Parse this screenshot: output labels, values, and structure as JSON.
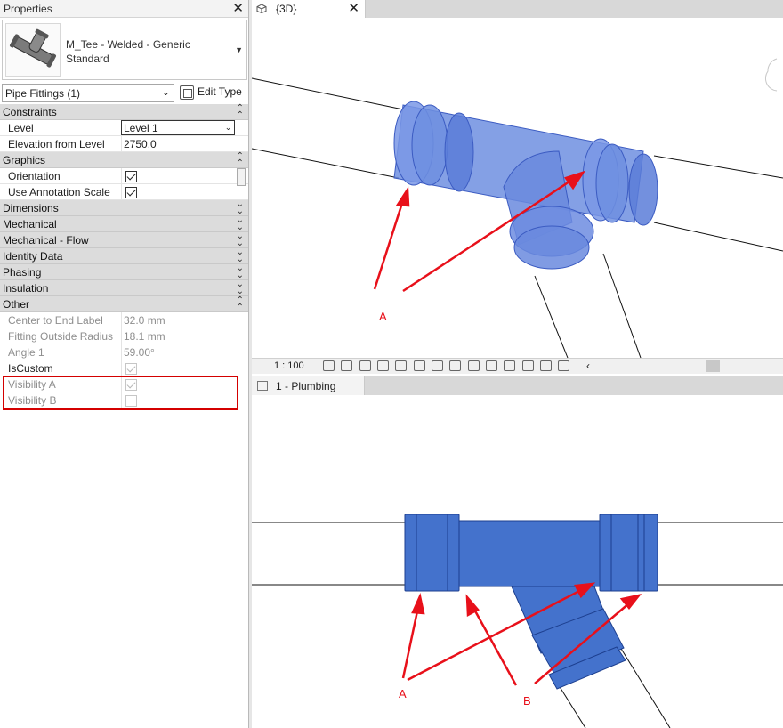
{
  "properties": {
    "title": "Properties",
    "type_name_line1": "M_Tee - Welded - Generic",
    "type_name_line2": "Standard",
    "filter": "Pipe Fittings (1)",
    "edit_type": "Edit Type",
    "groups": {
      "constraints": "Constraints",
      "graphics": "Graphics",
      "dimensions": "Dimensions",
      "mechanical": "Mechanical",
      "mechanical_flow": "Mechanical - Flow",
      "identity_data": "Identity Data",
      "phasing": "Phasing",
      "insulation": "Insulation",
      "other": "Other"
    },
    "params": {
      "level_label": "Level",
      "level_value": "Level 1",
      "elevation_label": "Elevation from Level",
      "elevation_value": "2750.0",
      "orientation_label": "Orientation",
      "use_annotation_label": "Use Annotation Scale",
      "center_to_end_label": "Center to End Label",
      "center_to_end_value": "32.0 mm",
      "fitting_radius_label": "Fitting Outside Radius",
      "fitting_radius_value": "18.1 mm",
      "angle1_label": "Angle 1",
      "angle1_value": "59.00°",
      "iscustom_label": "IsCustom",
      "visibility_a_label": "Visibility A",
      "visibility_b_label": "Visibility B"
    },
    "checks": {
      "orientation": true,
      "use_annotation": true,
      "iscustom": true,
      "visibility_a": true,
      "visibility_b": false
    }
  },
  "view3d": {
    "tab_label": "{3D}",
    "scale": "1 : 100",
    "annotation": "A"
  },
  "plan": {
    "tab_label": "1 - Plumbing",
    "annotation_a": "A",
    "annotation_b": "B"
  },
  "colors": {
    "fitting_3d": "#6f8fe0",
    "fitting_plan": "#4472cc",
    "arrow": "#e8101a",
    "highlight": "#d40000"
  }
}
